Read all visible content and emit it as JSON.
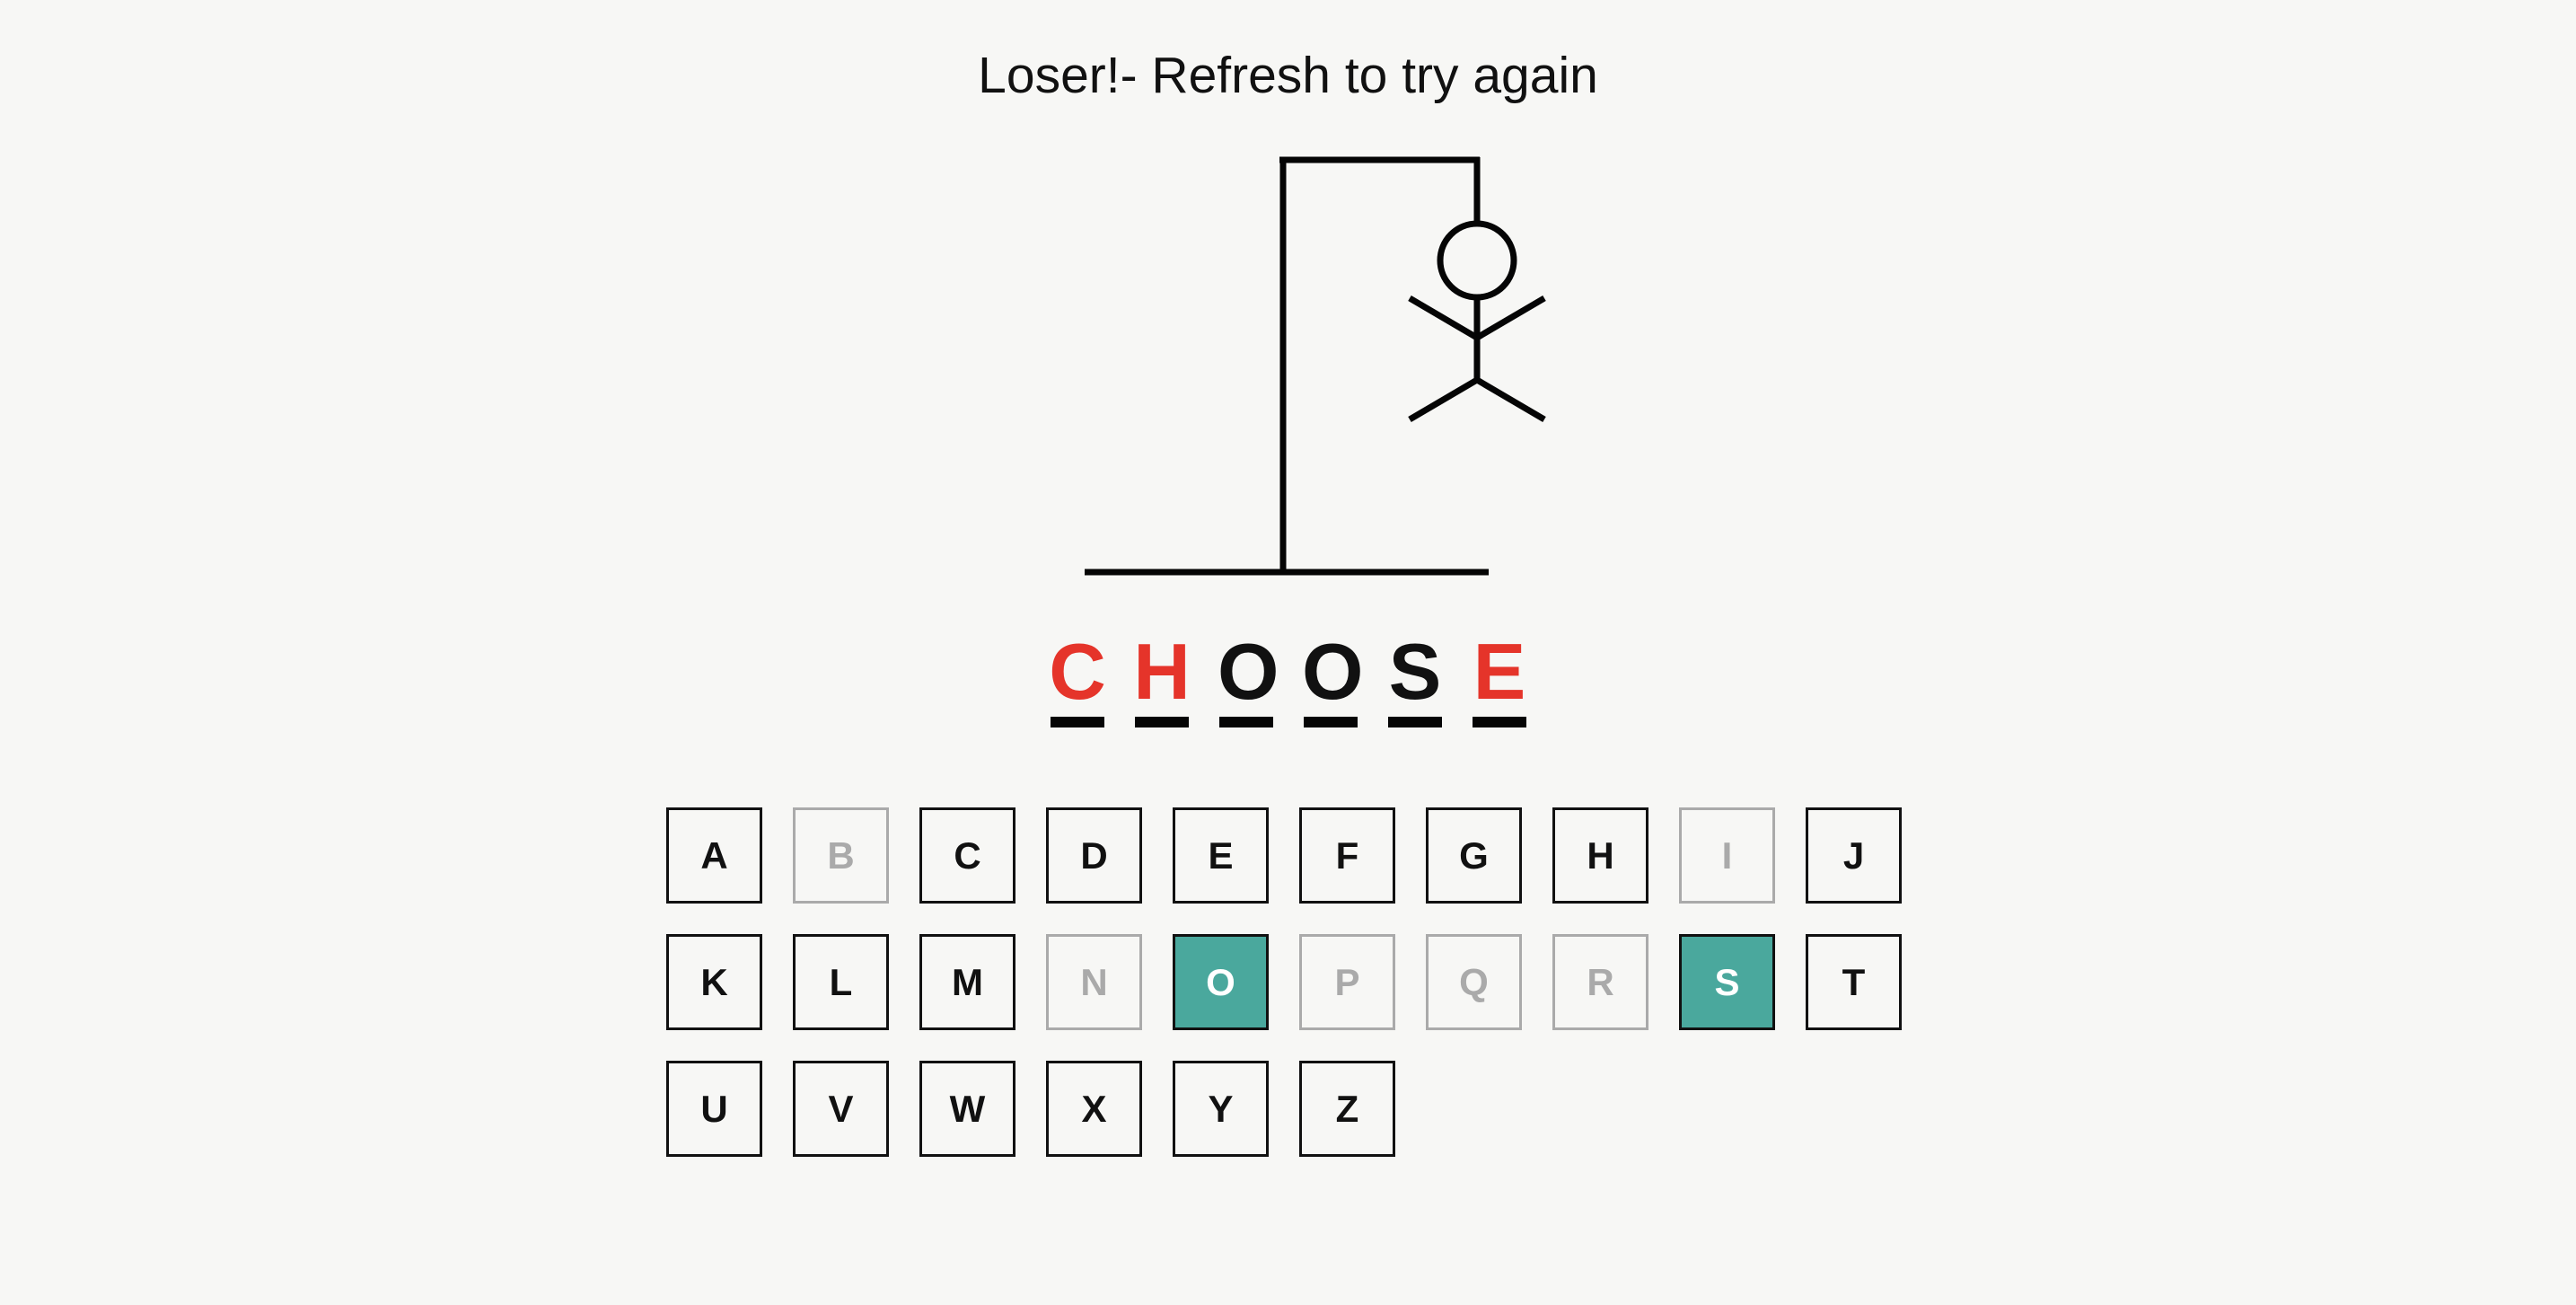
{
  "status_message": "Loser!- Refresh to try again",
  "colors": {
    "background": "#f7f7f5",
    "missed_letter": "#e5342a",
    "correct_key": "#4aa89d",
    "disabled_key": "#aaaaaa",
    "ink": "#111111"
  },
  "hangman": {
    "parts_shown": [
      "base",
      "pole",
      "beam",
      "rope",
      "head",
      "body",
      "left-arm",
      "right-arm",
      "left-leg",
      "right-leg"
    ]
  },
  "word": [
    {
      "char": "C",
      "state": "missed"
    },
    {
      "char": "H",
      "state": "missed"
    },
    {
      "char": "O",
      "state": "guessed"
    },
    {
      "char": "O",
      "state": "guessed"
    },
    {
      "char": "S",
      "state": "guessed"
    },
    {
      "char": "E",
      "state": "missed"
    }
  ],
  "keyboard": {
    "keys": [
      {
        "letter": "A",
        "state": "available"
      },
      {
        "letter": "B",
        "state": "disabled"
      },
      {
        "letter": "C",
        "state": "available"
      },
      {
        "letter": "D",
        "state": "available"
      },
      {
        "letter": "E",
        "state": "available"
      },
      {
        "letter": "F",
        "state": "available"
      },
      {
        "letter": "G",
        "state": "available"
      },
      {
        "letter": "H",
        "state": "available"
      },
      {
        "letter": "I",
        "state": "disabled"
      },
      {
        "letter": "J",
        "state": "available"
      },
      {
        "letter": "K",
        "state": "available"
      },
      {
        "letter": "L",
        "state": "available"
      },
      {
        "letter": "M",
        "state": "available"
      },
      {
        "letter": "N",
        "state": "disabled"
      },
      {
        "letter": "O",
        "state": "correct"
      },
      {
        "letter": "P",
        "state": "disabled"
      },
      {
        "letter": "Q",
        "state": "disabled"
      },
      {
        "letter": "R",
        "state": "disabled"
      },
      {
        "letter": "S",
        "state": "correct"
      },
      {
        "letter": "T",
        "state": "available"
      },
      {
        "letter": "U",
        "state": "available"
      },
      {
        "letter": "V",
        "state": "available"
      },
      {
        "letter": "W",
        "state": "available"
      },
      {
        "letter": "X",
        "state": "available"
      },
      {
        "letter": "Y",
        "state": "available"
      },
      {
        "letter": "Z",
        "state": "available"
      }
    ]
  }
}
